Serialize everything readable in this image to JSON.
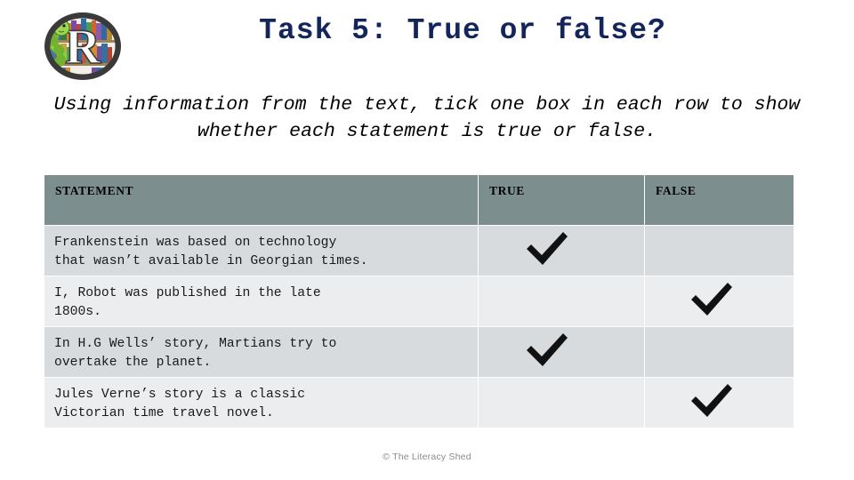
{
  "slide": {
    "title": "Task 5: True or false?",
    "instructions": "Using information from the text, tick one box in each row to show whether  each statement is true or false.",
    "footer": "© The Literacy Shed",
    "logo_alt": "literacy-shed-logo",
    "colors": {
      "title": "#13265c",
      "header_bg": "#7d8e8e",
      "row_dark": "#d8dbdd",
      "row_light": "#ebedee",
      "tick": "#111111",
      "footer_text": "#8b8b8b"
    }
  },
  "table": {
    "headers": {
      "statement": "STATEMENT",
      "true": "TRUE",
      "false": "FALSE"
    },
    "rows": [
      {
        "statement": "Frankenstein was based on technology\nthat wasn’t available in Georgian times.",
        "true_ticked": true,
        "false_ticked": false
      },
      {
        "statement": "I, Robot was published in the late\n1800s.",
        "true_ticked": false,
        "false_ticked": true
      },
      {
        "statement": "In H.G Wells’ story, Martians try to\novertake the planet.",
        "true_ticked": true,
        "false_ticked": false
      },
      {
        "statement": "Jules Verne’s story is a classic\nVictorian time travel novel.",
        "true_ticked": false,
        "false_ticked": true
      }
    ]
  }
}
